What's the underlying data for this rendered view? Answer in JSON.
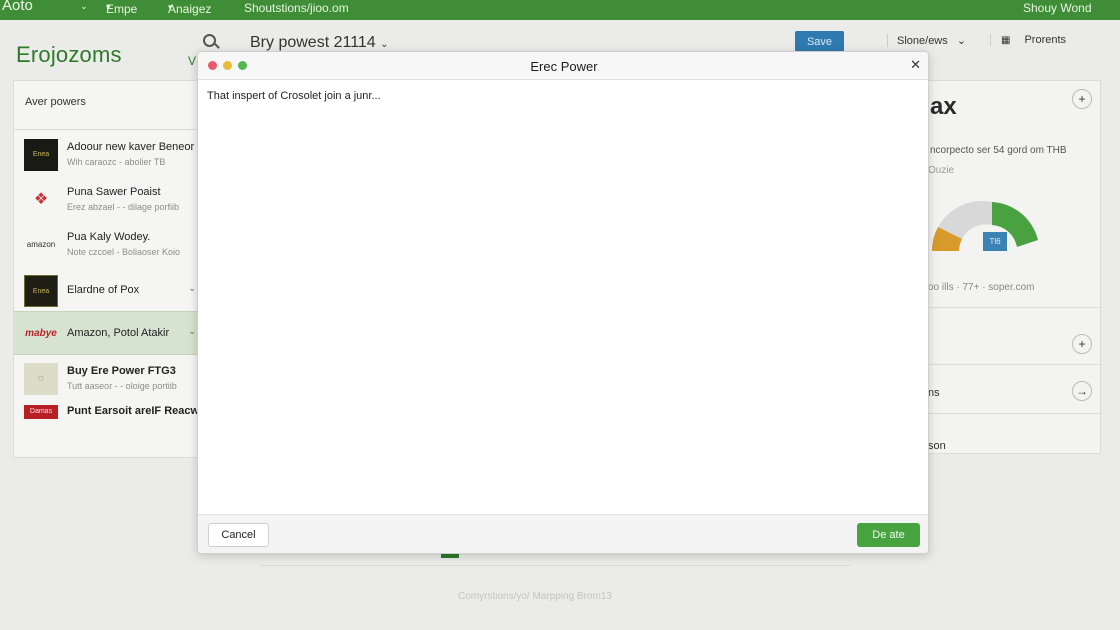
{
  "topbar": {
    "brand": "Aoto",
    "menus": [
      {
        "label": "Empe"
      },
      {
        "label": "Anaigez"
      },
      {
        "label": "Shoutstions/jioo.om"
      }
    ],
    "user": "Shouy Wond",
    "background_color": "#3f8e37"
  },
  "header": {
    "logo": "Erojozoms",
    "search_icon": "search-icon",
    "sub_label": "V",
    "doc_title": "Bry powest 21114",
    "save_label": "Save",
    "sort_label": "Slone/ews",
    "projects_label": "Prorents",
    "save_color": "#2f7ab0"
  },
  "sidebar": {
    "heading": "Aver powers",
    "items": [
      {
        "title": "Adoour new kaver Beneor",
        "subtitle": "Wih caraozc - abolier TB",
        "thumb": "Enea"
      },
      {
        "title": "Puna Sawer Poaist",
        "subtitle": "Erez abzael - - dilage porfiib",
        "thumb": "❖"
      },
      {
        "title": "Pua Kaly Wodey.",
        "subtitle": "Note czcoel - Boliaoser Koio",
        "thumb": "amazon"
      },
      {
        "title": "Elardne of Pox",
        "subtitle": "",
        "thumb": "Enea"
      },
      {
        "title": "Amazon, Potol Atakir",
        "subtitle": "",
        "thumb": "mabye"
      },
      {
        "title": "Buy Ere Power FTG3",
        "subtitle": "Tutt aaseor - - oloige portiib",
        "thumb": "◻"
      },
      {
        "title": "Punt Earsoit areIF Reacwo",
        "subtitle": "",
        "thumb": "Damas"
      }
    ],
    "active_color": "#d6e3d0"
  },
  "right_panel": {
    "logo": "ax",
    "stat_line": "ncorpecto ser 54 gord om THB",
    "stat_sub": "Ouzie",
    "badge": "Tl6",
    "donut_caption": "oo ills · 77+ · soper.com",
    "row_a": "ns",
    "row_b": "son",
    "donut_colors": [
      "#4aa13f",
      "#d89a2b",
      "#d8d8d8"
    ]
  },
  "background_footer": "Comyrstions/yo/ Marpping Brom13",
  "modal": {
    "title": "Erec Power",
    "body_text": "That inspert of Crosolet join a junr...",
    "cancel_label": "Cancel",
    "confirm_label": "De ate",
    "confirm_color": "#46a340",
    "close_icon": "close-icon"
  }
}
